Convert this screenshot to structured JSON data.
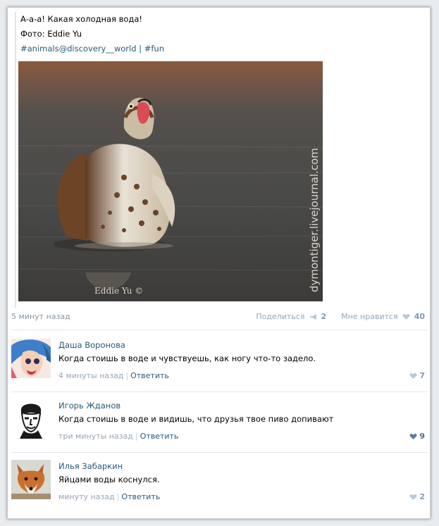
{
  "post": {
    "text_line1": "А-а-а! Какая холодная вода!",
    "text_line2": "Фото: Eddie Yu",
    "hashtag1": "#animals@discovery__world",
    "hashtag_sep": "|",
    "hashtag2": "#fun",
    "photo_signature": "Eddie Yu ©",
    "photo_watermark": "dymontiger.livejournal.com",
    "time": "5 минут назад",
    "share_label": "Поделиться",
    "share_count": "2",
    "like_label": "Мне нравится",
    "like_count": "40"
  },
  "comments": [
    {
      "name": "Даша Воронова",
      "text": "Когда стоишь в воде и чувствуешь, как ногу что-то задело.",
      "time": "4 минуты назад",
      "reply": "Ответить",
      "likes": "7"
    },
    {
      "name": "Игорь Жданов",
      "text": "Когда стоишь в воде и видишь, что друзья твое пиво допивают",
      "time": "три минуты назад",
      "reply": "Ответить",
      "likes": "9"
    },
    {
      "name": "Илья Забаркин",
      "text": "Яйцами воды коснулся.",
      "time": "минуту назад",
      "reply": "Ответить",
      "likes": "2"
    }
  ],
  "colors": {
    "link": "#2b587a",
    "muted": "#9aa5b1",
    "heart": "#a9bfd3"
  }
}
